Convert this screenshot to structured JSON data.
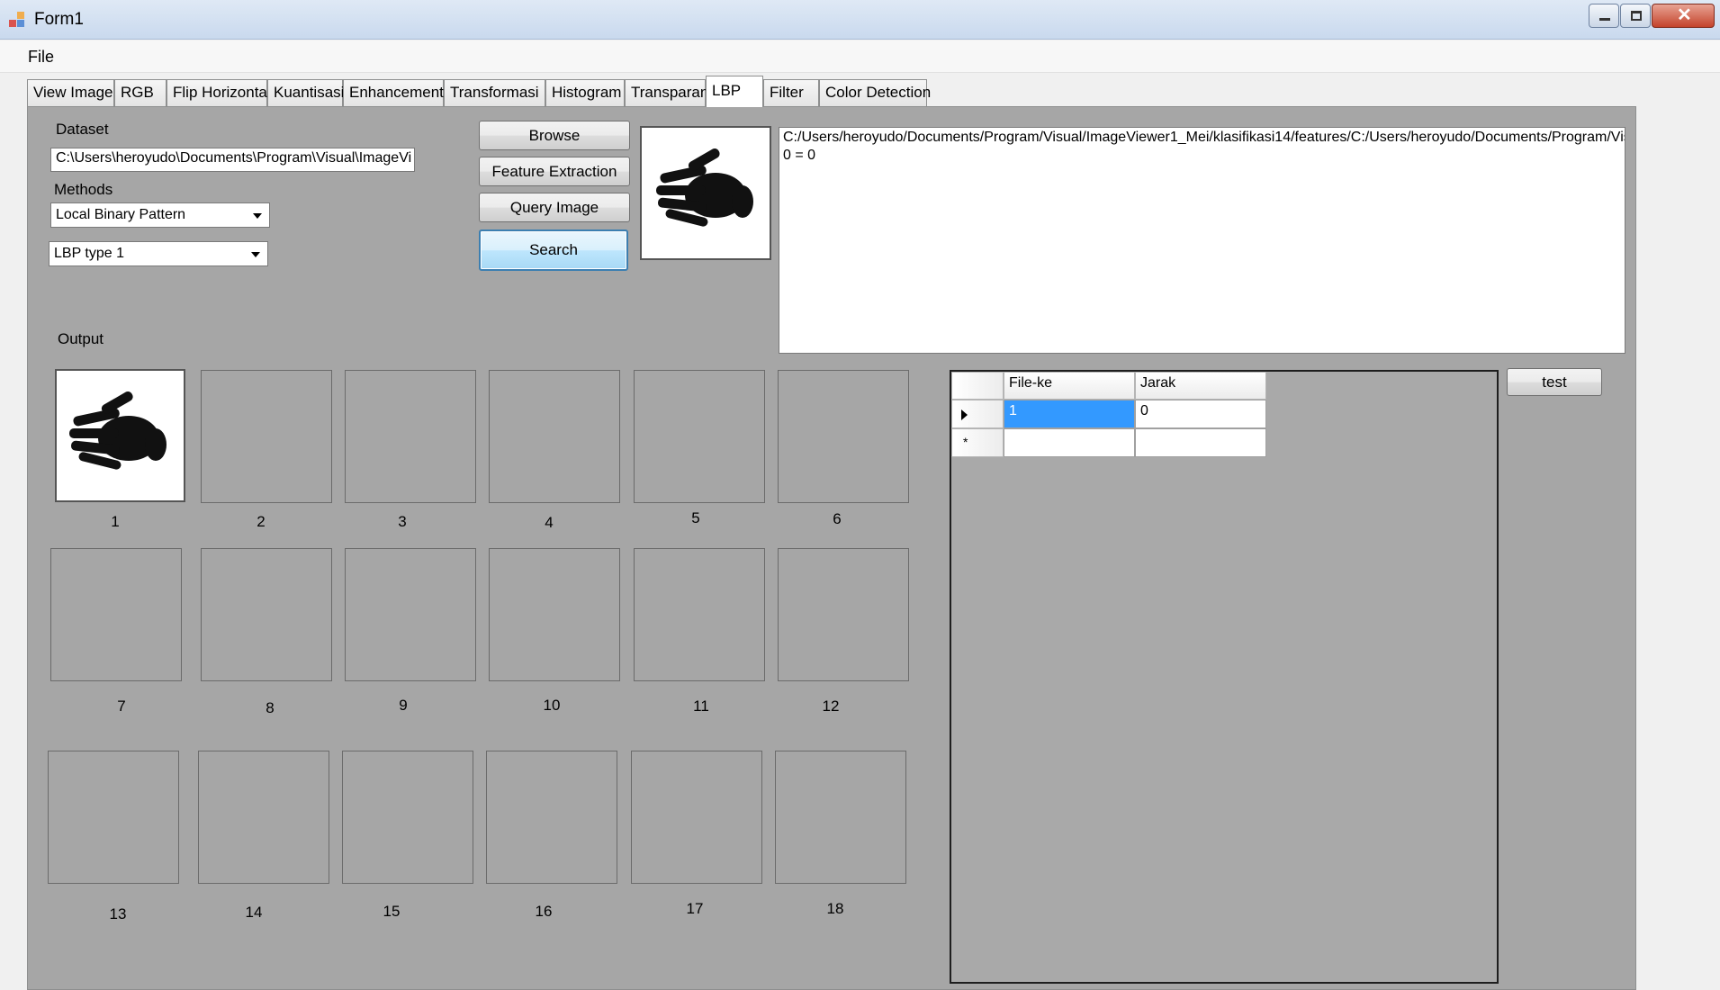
{
  "window": {
    "title": "Form1"
  },
  "menu": {
    "file_label": "File"
  },
  "tabs": [
    {
      "label": "View Image"
    },
    {
      "label": "RGB"
    },
    {
      "label": "Flip Horizontal"
    },
    {
      "label": "Kuantisasi"
    },
    {
      "label": "Enhancement"
    },
    {
      "label": "Transformasi"
    },
    {
      "label": "Histogram"
    },
    {
      "label": "Transparan"
    },
    {
      "label": "LBP",
      "active": true
    },
    {
      "label": "Filter"
    },
    {
      "label": "Color Detection"
    }
  ],
  "dataset": {
    "label": "Dataset",
    "path_value": "C:\\Users\\heroyudo\\Documents\\Program\\Visual\\ImageVi"
  },
  "methods": {
    "label": "Methods",
    "method_value": "Local Binary Pattern",
    "type_value": "LBP type 1"
  },
  "buttons": {
    "browse": "Browse",
    "feature_extraction": "Feature Extraction",
    "query_image": "Query Image",
    "search": "Search",
    "test": "test"
  },
  "output_text": {
    "line1": "C:/Users/heroyudo/Documents/Program/Visual/ImageViewer1_Mei/klasifikasi14/features/C:/Users/heroyudo/Documents/Program/Vis",
    "line2": "0 = 0"
  },
  "output": {
    "label": "Output",
    "slots": [
      "1",
      "2",
      "3",
      "4",
      "5",
      "6",
      "7",
      "8",
      "9",
      "10",
      "11",
      "12",
      "13",
      "14",
      "15",
      "16",
      "17",
      "18"
    ]
  },
  "results_grid": {
    "columns": [
      "File-ke",
      "Jarak"
    ],
    "rows": [
      {
        "file_ke": "1",
        "jarak": "0"
      }
    ],
    "new_row_marker": "*"
  },
  "colors": {
    "tab_page_bg": "#a6a6a6",
    "selection": "#3399ff"
  }
}
